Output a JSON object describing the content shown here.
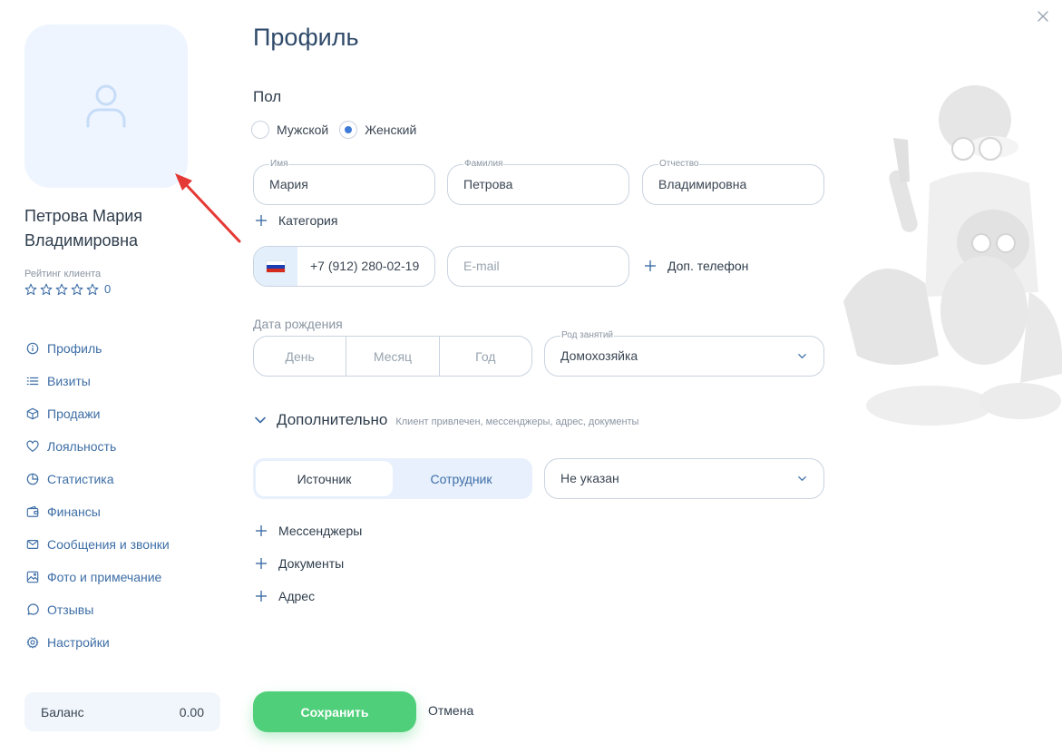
{
  "sidebar": {
    "client_name": "Петрова Мария Владимировна",
    "rating_label": "Рейтинг клиента",
    "rating_stars": 0,
    "rating_max": 5,
    "rating_value": "0",
    "nav": [
      {
        "label": "Профиль",
        "icon": "info-icon",
        "active": true
      },
      {
        "label": "Визиты",
        "icon": "list-icon"
      },
      {
        "label": "Продажи",
        "icon": "box-icon"
      },
      {
        "label": "Лояльность",
        "icon": "heart-icon"
      },
      {
        "label": "Статистика",
        "icon": "pie-chart-icon"
      },
      {
        "label": "Финансы",
        "icon": "wallet-icon"
      },
      {
        "label": "Сообщения и звонки",
        "icon": "mail-icon"
      },
      {
        "label": "Фото и примечание",
        "icon": "image-icon"
      },
      {
        "label": "Отзывы",
        "icon": "chat-icon"
      },
      {
        "label": "Настройки",
        "icon": "gear-icon"
      }
    ],
    "balance": {
      "label": "Баланс",
      "value": "0.00"
    }
  },
  "main": {
    "title": "Профиль",
    "gender": {
      "title": "Пол",
      "options": [
        {
          "label": "Мужской",
          "checked": false
        },
        {
          "label": "Женский",
          "checked": true
        }
      ]
    },
    "first_name": {
      "label": "Имя",
      "value": "Мария"
    },
    "last_name": {
      "label": "Фамилия",
      "value": "Петрова"
    },
    "patronymic": {
      "label": "Отчество",
      "value": "Владимировна"
    },
    "add_category": "Категория",
    "phone": {
      "value": "+7 (912) 280-02-19",
      "flag": "russia-flag-icon"
    },
    "email": {
      "placeholder": "E-mail"
    },
    "add_phone": "Доп. телефон",
    "dob": {
      "label": "Дата рождения",
      "day": "День",
      "month": "Месяц",
      "year": "Год"
    },
    "occupation": {
      "label": "Род занятий",
      "value": "Домохозяйка"
    },
    "additional": {
      "title": "Дополнительно",
      "hint": "Клиент привлечен, мессенджеры, адрес, документы"
    },
    "source_tabs": [
      {
        "label": "Источник",
        "active": true
      },
      {
        "label": "Сотрудник",
        "active": false
      }
    ],
    "source_select": {
      "value": "Не указан"
    },
    "add_messengers": "Мессенджеры",
    "add_documents": "Документы",
    "add_address": "Адрес",
    "save_label": "Сохранить",
    "cancel_label": "Отмена"
  },
  "colors": {
    "accent_blue": "#3e6ea6",
    "save_green": "#4fcf7a",
    "avatar_bg": "#eef5ff",
    "annotation_arrow": "#e53935"
  }
}
